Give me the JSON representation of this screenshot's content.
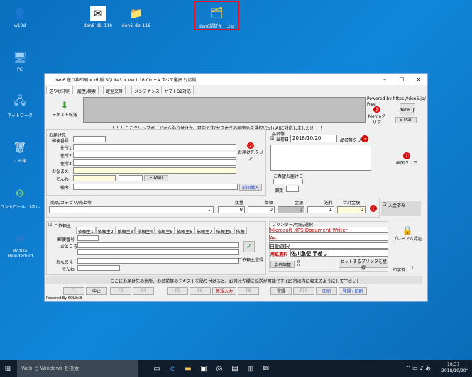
{
  "desktop": {
    "icons": [
      "w10d",
      "den6_db_116",
      "den6_db_116",
      "den6認証キー.zip",
      "PC",
      "ネットワーク",
      "ごみ箱",
      "コントロール パネル",
      "Mozilla Thunderbird"
    ]
  },
  "window": {
    "title": "den6 送り状印刷 < db版 SQLite3 >  ver1.16   Ctrl+A すべて選択  対応版",
    "tabs": [
      "送り状印刷",
      "履歴/検索",
      "定型文等",
      "メンテナンス",
      "ヤマトB2対応"
    ],
    "paste_btn": "テキスト転送",
    "powered_url": "Powered by https://den6.jp/",
    "free": "Free",
    "memo_clear": "Memoクリア",
    "den6": "den6.jp",
    "email_btn": "E-Mail",
    "notice": "！！！ここクリップボードから貼り付けか、可能です(ヤフオクの画面の全選択(Ctrl+A)に対応しました)！！！",
    "dest": {
      "title": "お届け先",
      "zip": "郵便番号",
      "addr1": "住所1",
      "addr2": "住所2",
      "addr3": "住所3",
      "name": "おなまえ",
      "tel": "でんわ",
      "note": "備考",
      "clear": "お届け先クリア",
      "email": "E-Mail",
      "prev": "前回購入"
    },
    "item": {
      "title": "品名等",
      "ship_date_label": "出荷日",
      "ship_date": "2018/10/20",
      "item_clear": "品名等クリア",
      "delivery": "ご希望お届け日",
      "count": "個数",
      "screen_clear": "画面クリア"
    },
    "goods": {
      "title": "商品/カテゴリ/売上等",
      "qty": "数量",
      "price": "単価",
      "amount": "金額",
      "shipping": "送料",
      "total": "合計金額",
      "v_qty": "0",
      "v_price": "0",
      "v_amount": "0",
      "v_ship": "1",
      "v_total": "0",
      "paid": "入金済み"
    },
    "sender": {
      "title": "ご依頼主",
      "tabs": [
        "依頼主1",
        "依頼主2",
        "依頼主3",
        "依頼主4",
        "依頼主5",
        "依頼主6",
        "依頼主7",
        "依頼主8",
        "依頼"
      ],
      "zip": "郵便番号",
      "addr": "おところ",
      "name": "おなまえ",
      "tel": "でんわ",
      "reg": "ご依頼主登録"
    },
    "printer": {
      "title": "プリンター/用紙/選択",
      "name": "Microsoft XPS Document Writer",
      "paper": "A4",
      "auto": "自動選択",
      "paper_sel_label": "用紙選択",
      "paper_sel": "佐川急便     手差し",
      "margin": "余白調整",
      "margin_vals": "0\n0",
      "set_printer": "セットするプリンタを登録",
      "premium": "プレミアム認証",
      "print_date": "印字済"
    },
    "hint": "ここにお届け先の住所、お名前等のテキストを貼り付けると、お届け先欄に転送が可能です  (15行以内に収まるようにして下さい)",
    "fkeys": [
      "F1",
      "中止",
      "F3",
      "F4",
      "F5",
      "F6",
      "新規入力",
      "F8",
      "登録",
      "F10",
      "印刷",
      "登録+印刷"
    ],
    "status": "Powered By SQLite3"
  },
  "taskbar": {
    "search": "Web と Windows を検索",
    "time": "10:37",
    "date": "2018/10/20"
  }
}
